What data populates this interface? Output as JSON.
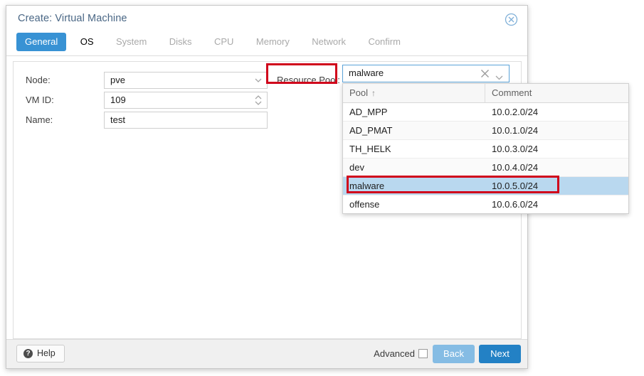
{
  "dialog": {
    "title": "Create: Virtual Machine",
    "close_icon": "close-circle-icon"
  },
  "tabs": [
    {
      "label": "General",
      "state": "active"
    },
    {
      "label": "OS",
      "state": "enabled"
    },
    {
      "label": "System",
      "state": "disabled"
    },
    {
      "label": "Disks",
      "state": "disabled"
    },
    {
      "label": "CPU",
      "state": "disabled"
    },
    {
      "label": "Memory",
      "state": "disabled"
    },
    {
      "label": "Network",
      "state": "disabled"
    },
    {
      "label": "Confirm",
      "state": "disabled"
    }
  ],
  "form": {
    "node": {
      "label": "Node:",
      "value": "pve"
    },
    "vmid": {
      "label": "VM ID:",
      "value": "109"
    },
    "name": {
      "label": "Name:",
      "value": "test"
    },
    "resource_pool": {
      "label": "Resource Pool:",
      "value": "malware",
      "clear_icon": "clear-x-icon",
      "chevron_icon": "chevron-down-icon"
    }
  },
  "pool_dropdown": {
    "columns": [
      "Pool",
      "Comment"
    ],
    "sort_indicator": "↑",
    "sorted_column": "Pool",
    "selected": "malware",
    "rows": [
      {
        "pool": "AD_MPP",
        "comment": "10.0.2.0/24"
      },
      {
        "pool": "AD_PMAT",
        "comment": "10.0.1.0/24"
      },
      {
        "pool": "TH_HELK",
        "comment": "10.0.3.0/24"
      },
      {
        "pool": "dev",
        "comment": "10.0.4.0/24"
      },
      {
        "pool": "malware",
        "comment": "10.0.5.0/24"
      },
      {
        "pool": "offense",
        "comment": "10.0.6.0/24"
      }
    ]
  },
  "footer": {
    "help_label": "Help",
    "help_icon": "question-circle-icon",
    "advanced_label": "Advanced",
    "advanced_checked": false,
    "back_label": "Back",
    "next_label": "Next"
  },
  "annotations": {
    "accent_color": "#d0021b",
    "items": [
      "resource-pool-label",
      "malware-row"
    ]
  },
  "colors": {
    "active_tab": "#3892d4",
    "primary_button": "#2381c5",
    "secondary_button": "#85bce4",
    "title_text": "#4a6785",
    "selection_row": "#b9d8ef"
  }
}
